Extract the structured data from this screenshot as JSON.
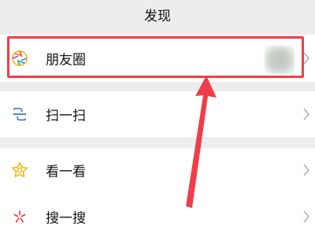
{
  "header": {
    "title": "发现"
  },
  "rows": [
    {
      "label": "朋友圈",
      "icon": "moments-aperture-icon"
    },
    {
      "label": "扫一扫",
      "icon": "scan-icon"
    },
    {
      "label": "看一看",
      "icon": "look-icon"
    },
    {
      "label": "搜一搜",
      "icon": "search-sparkle-icon"
    }
  ],
  "colors": {
    "highlight": "#ef3e4a",
    "background": "#ededed",
    "row": "#ffffff"
  }
}
